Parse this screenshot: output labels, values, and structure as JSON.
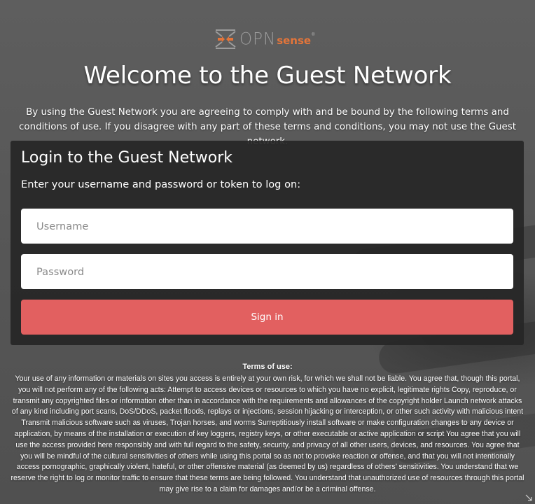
{
  "logo": {
    "text_main": "OPN",
    "text_accent": "sense",
    "registered": "®"
  },
  "header": {
    "title": "Welcome to the Guest Network",
    "intro": "By using the Guest Network you are agreeing to comply with and be bound by the following terms and conditions of use. If you disagree with any part of these terms and conditions, you may not use the Guest network."
  },
  "login": {
    "title": "Login to the Guest Network",
    "subtitle": "Enter your username and password or token to log on:",
    "username_placeholder": "Username",
    "password_placeholder": "Password",
    "signin_label": "Sign in"
  },
  "terms": {
    "title": "Terms of use:",
    "body": "Your use of any information or materials on sites you access is entirely at your own risk, for which we shall not be liable. You agree that, though this portal, you will not perform any of the following acts: Attempt to access devices or resources to which you have no explicit, legitimate rights Copy, reproduce, or transmit any copyrighted files or information other than in accordance with the requirements and allowances of the copyright holder Launch network attacks of any kind including port scans, DoS/DDoS, packet floods, replays or injections, session hijacking or interception, or other such activity with malicious intent Transmit malicious software such as viruses, Trojan horses, and worms Surreptitiously install software or make configuration changes to any device or application, by means of the installation or execution of key loggers, registry keys, or other executable or active application or script You agree that you will use the access provided here responsibly and with full regard to the safety, security, and privacy of all other users, devices, and resources. You agree that you will be mindful of the cultural sensitivities of others while using this portal so as not to provoke reaction or offense, and that you will not intentionally access pornographic, graphically violent, hateful, or other offensive material (as deemed by us) regardless of others’ sensitivities. You understand that we reserve the right to log or monitor traffic to ensure that these terms are being followed. You understand that unauthorized use of resources through this portal may give rise to a claim for damages and/or be a criminal offense."
  },
  "colors": {
    "brand_orange": "#e4753a",
    "signin_button": "#e26060",
    "panel_bg": "#262626"
  }
}
